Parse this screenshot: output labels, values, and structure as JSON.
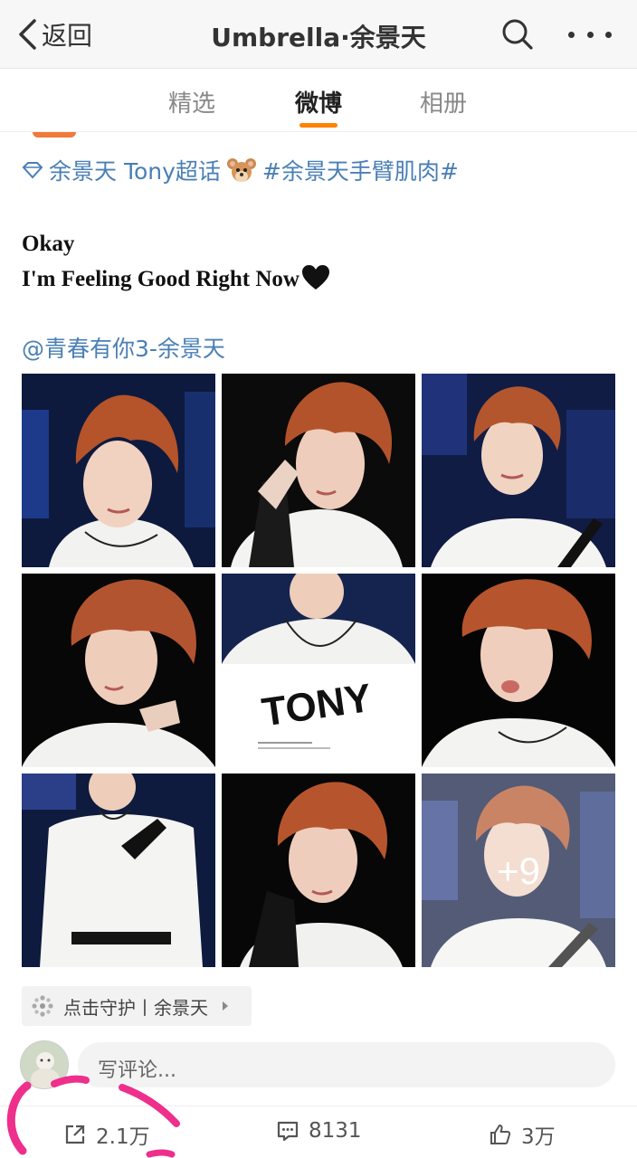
{
  "nav": {
    "back_label": "返回",
    "title": "Umbrella·余景天",
    "search_icon": "search-icon",
    "more_icon": "more-icon"
  },
  "tabs": [
    {
      "label": "精选",
      "active": false
    },
    {
      "label": "微博",
      "active": true
    },
    {
      "label": "相册",
      "active": false
    }
  ],
  "accent_color": "#ff8200",
  "link_color": "#4a7fb5",
  "post": {
    "topic": "余景天 Tony超话",
    "hashtag": "#余景天手臂肌肉#",
    "body_line1": "Okay",
    "body_line2": "I'm Feeling Good Right Now",
    "mention": "@青春有你3-余景天",
    "photos": [
      {
        "kind": "portrait"
      },
      {
        "kind": "portrait"
      },
      {
        "kind": "portrait"
      },
      {
        "kind": "portrait"
      },
      {
        "kind": "logo",
        "logo_text": "TONY"
      },
      {
        "kind": "portrait"
      },
      {
        "kind": "portrait"
      },
      {
        "kind": "portrait"
      },
      {
        "kind": "portrait",
        "more_count": "+9"
      }
    ],
    "logo_text": "TONY",
    "more_count": "+9"
  },
  "guard": {
    "label": "点击守护丨余景天"
  },
  "comment": {
    "placeholder": "写评论..."
  },
  "actions": {
    "repost_count": "2.1万",
    "comment_count": "8131",
    "like_count": "3万"
  }
}
